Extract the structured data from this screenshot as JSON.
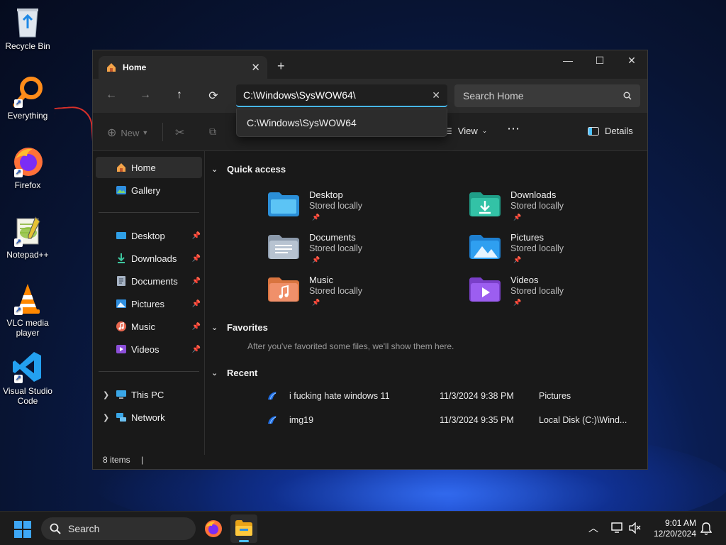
{
  "desktop": {
    "icons": [
      {
        "label": "Recycle Bin",
        "icon": "recycle-bin-icon"
      },
      {
        "label": "Everything",
        "icon": "everything-search-icon"
      },
      {
        "label": "Firefox",
        "icon": "firefox-icon"
      },
      {
        "label": "Notepad++",
        "icon": "notepadpp-icon"
      },
      {
        "label": "VLC media player",
        "icon": "vlc-icon"
      },
      {
        "label": "Visual Studio Code",
        "icon": "vscode-icon"
      }
    ]
  },
  "window": {
    "tab_title": "Home",
    "address_value": "C:\\Windows\\SysWOW64\\",
    "address_suggestion": "C:\\Windows\\SysWOW64",
    "search_placeholder": "Search Home",
    "toolbar": {
      "new_label": "New",
      "view_label": "View",
      "details_label": "Details"
    },
    "sidebar": {
      "top": [
        {
          "label": "Home"
        },
        {
          "label": "Gallery"
        }
      ],
      "pinned": [
        {
          "label": "Desktop"
        },
        {
          "label": "Downloads"
        },
        {
          "label": "Documents"
        },
        {
          "label": "Pictures"
        },
        {
          "label": "Music"
        },
        {
          "label": "Videos"
        }
      ],
      "bottom": [
        {
          "label": "This PC"
        },
        {
          "label": "Network"
        }
      ]
    },
    "quick_access": {
      "heading": "Quick access",
      "items": [
        {
          "name": "Desktop",
          "sub": "Stored locally"
        },
        {
          "name": "Downloads",
          "sub": "Stored locally"
        },
        {
          "name": "Documents",
          "sub": "Stored locally"
        },
        {
          "name": "Pictures",
          "sub": "Stored locally"
        },
        {
          "name": "Music",
          "sub": "Stored locally"
        },
        {
          "name": "Videos",
          "sub": "Stored locally"
        }
      ]
    },
    "favorites": {
      "heading": "Favorites",
      "note": "After you've favorited some files, we'll show them here."
    },
    "recent": {
      "heading": "Recent",
      "rows": [
        {
          "name": "i fucking hate windows 11",
          "date": "11/3/2024 9:38 PM",
          "location": "Pictures"
        },
        {
          "name": "img19",
          "date": "11/3/2024 9:35 PM",
          "location": "Local Disk (C:)\\Wind..."
        }
      ]
    },
    "status": {
      "items": "8 items"
    }
  },
  "taskbar": {
    "search_placeholder": "Search",
    "time": "9:01 AM",
    "date": "12/20/2024"
  },
  "colors": {
    "accent": "#4cc2ff",
    "window_bg": "#191919",
    "toolbar_bg": "#202020"
  }
}
